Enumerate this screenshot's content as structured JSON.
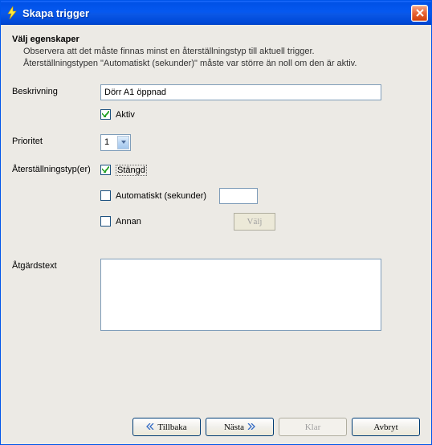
{
  "window": {
    "title": "Skapa trigger"
  },
  "head": {
    "title": "Välj egenskaper",
    "line1": "Observera att det måste finnas minst en återställningstyp till aktuell trigger.",
    "line2": "Återställningstypen \"Automatiskt (sekunder)\" måste var större än noll om den är aktiv."
  },
  "labels": {
    "description": "Beskrivning",
    "priority": "Prioritet",
    "resetTypes": "Återställningstyp(er)",
    "actionText": "Åtgärdstext"
  },
  "values": {
    "description": "Dörr A1 öppnad",
    "priority": "1",
    "autoSeconds": "",
    "actionText": ""
  },
  "checks": {
    "active": {
      "label": "Aktiv",
      "checked": true
    },
    "closed": {
      "label": "Stängd",
      "checked": true
    },
    "auto": {
      "label": "Automatiskt (sekunder)",
      "checked": false
    },
    "other": {
      "label": "Annan",
      "checked": false
    }
  },
  "buttons": {
    "select": "Välj",
    "back": "Tillbaka",
    "next": "Nästa",
    "finish": "Klar",
    "cancel": "Avbryt"
  }
}
